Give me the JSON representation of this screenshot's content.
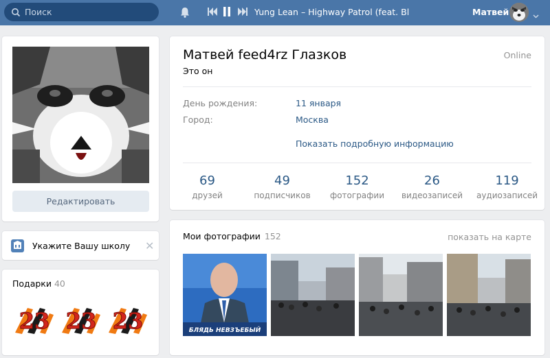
{
  "header": {
    "search_placeholder": "Поиск",
    "now_playing": "Yung Lean – Highway Patrol (feat. Bla...",
    "user_name": "Матвей",
    "icons": [
      "search-icon",
      "bell-icon",
      "previous-icon",
      "pause-icon",
      "next-icon",
      "chevron-down-icon"
    ]
  },
  "left": {
    "edit_label": "Редактировать",
    "school_prompt": "Укажите Вашу школу",
    "school_close": "✕",
    "gifts_title": "Подарки",
    "gifts_count": "40",
    "gift_label": "23"
  },
  "profile": {
    "name": "Матвей feed4rz Глазков",
    "status": "Это он",
    "online": "Online",
    "info": [
      {
        "label": "День рождения:",
        "value": "11 января"
      },
      {
        "label": "Город:",
        "value": "Москва"
      }
    ],
    "more_info": "Показать подробную информацию",
    "counters": [
      {
        "num": "69",
        "label": "друзей"
      },
      {
        "num": "49",
        "label": "подписчиков"
      },
      {
        "num": "152",
        "label": "фотографии"
      },
      {
        "num": "26",
        "label": "видеозаписей"
      },
      {
        "num": "119",
        "label": "аудиозаписей"
      }
    ]
  },
  "photos": {
    "title": "Мои фотографии",
    "count": "152",
    "map_link": "показать на карте",
    "first_caption": "БЛЯДЬ НЕВЗЪЕБЫЙ"
  },
  "colors": {
    "header_bg": "#4a76a8",
    "link": "#2a5885",
    "muted": "#828282",
    "page_bg": "#edeef0"
  }
}
